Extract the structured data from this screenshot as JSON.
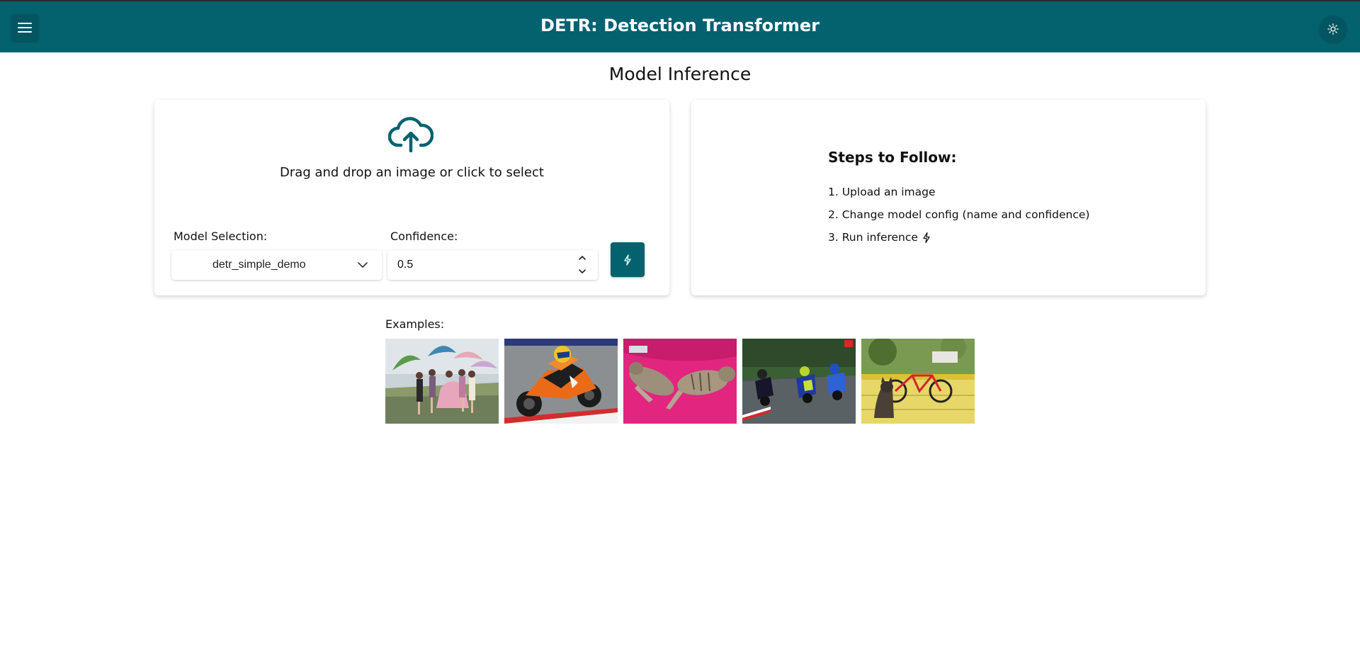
{
  "app_bar": {
    "title": "DETR: Detection Transformer",
    "menu_icon": "hamburger-menu-icon",
    "theme_icon": "sun-icon",
    "color": "#04626f"
  },
  "page": {
    "title": "Model Inference"
  },
  "upload": {
    "icon": "cloud-upload-icon",
    "prompt": "Drag and drop an image or click to select"
  },
  "model_selection": {
    "label": "Model Selection:",
    "selected": "detr_simple_demo",
    "icon": "chevron-down-icon"
  },
  "confidence": {
    "label": "Confidence:",
    "value": "0.5"
  },
  "run_button": {
    "icon": "lightning-bolt-icon"
  },
  "steps": {
    "title": "Steps to Follow:",
    "items": [
      {
        "text": "1. Upload an image"
      },
      {
        "text": "2. Change model config (name and confidence)"
      },
      {
        "text": "3. Run inference",
        "icon": "lightning-bolt-icon"
      }
    ]
  },
  "examples": {
    "label": "Examples:",
    "items": [
      {
        "subject": "women-with-umbrellas"
      },
      {
        "subject": "motorcycle-racer"
      },
      {
        "subject": "cats-on-pink-blanket"
      },
      {
        "subject": "three-motorcycles-on-track"
      },
      {
        "subject": "dog-with-bicycle"
      }
    ]
  }
}
